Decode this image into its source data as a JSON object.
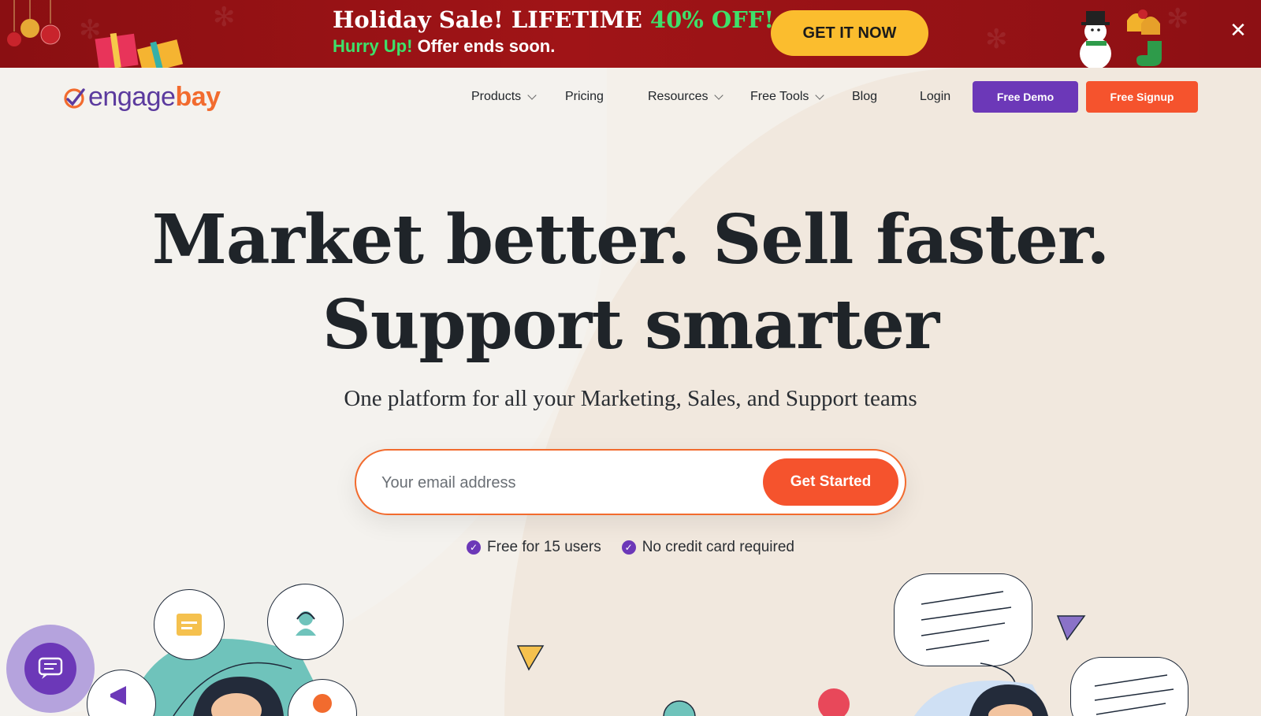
{
  "promo": {
    "headline_prefix": "Holiday Sale! LIFETIME ",
    "headline_accent": "40% OFF!",
    "subline_accent": "Hurry Up!",
    "subline_rest": " Offer ends soon.",
    "cta_label": "GET IT NOW",
    "close_glyph": "✕",
    "colors": {
      "background": "#8a0f12",
      "accent": "#3ee06a",
      "cta": "#fbbd2e"
    }
  },
  "header": {
    "logo_engage": "engage",
    "logo_bay": "bay",
    "nav": [
      {
        "label": "Products",
        "has_dropdown": true
      },
      {
        "label": "Pricing",
        "has_dropdown": false
      },
      {
        "label": "Resources",
        "has_dropdown": true
      },
      {
        "label": "Free Tools",
        "has_dropdown": true
      },
      {
        "label": "Blog",
        "has_dropdown": false
      },
      {
        "label": "Login",
        "has_dropdown": false
      }
    ],
    "demo_label": "Free Demo",
    "signup_label": "Free Signup",
    "colors": {
      "brand_purple": "#6c38b8",
      "brand_orange": "#f5532d"
    }
  },
  "hero": {
    "title_line1": "Market better. Sell faster.",
    "title_line2": "Support smarter",
    "subtitle": "One platform for all your Marketing, Sales, and Support teams",
    "email_placeholder": "Your email address",
    "cta_label": "Get Started",
    "perks": [
      "Free for 15 users",
      "No credit card required"
    ],
    "check_glyph": "✓"
  },
  "illustration_icons": [
    "archive-icon",
    "headset-icon",
    "megaphone-icon",
    "chat-icon"
  ]
}
